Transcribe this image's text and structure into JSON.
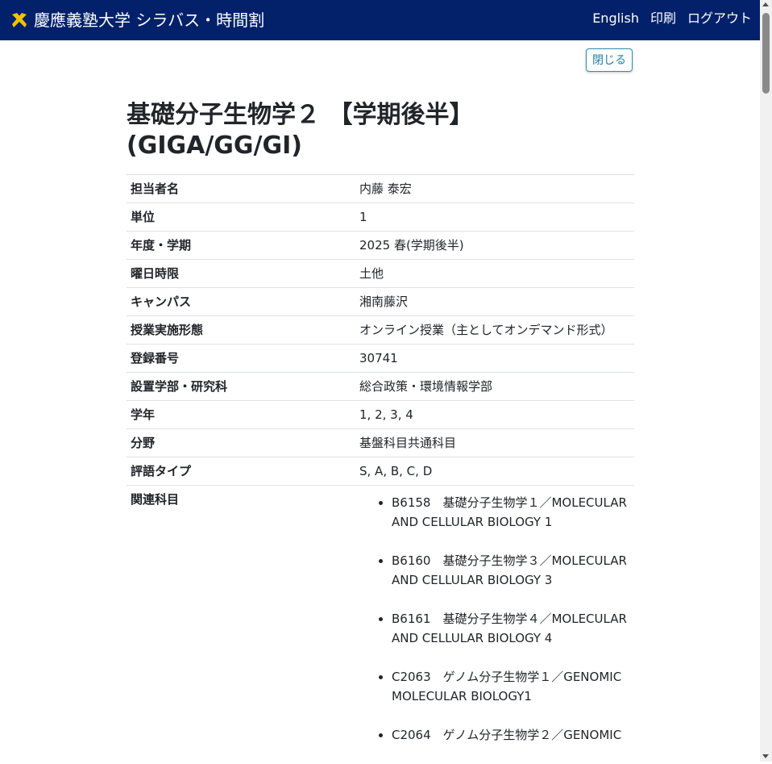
{
  "header": {
    "title": "慶應義塾大学 シラバス・時間割",
    "nav": [
      "English",
      "印刷",
      "ログアウト"
    ]
  },
  "close_button": "閉じる",
  "course": {
    "title": "基礎分子生物学２ 【学期後半】 (GIGA/GG/GI)"
  },
  "details": [
    {
      "label": "担当者名",
      "value": "内藤 泰宏"
    },
    {
      "label": "単位",
      "value": "1"
    },
    {
      "label": "年度・学期",
      "value": "2025 春(学期後半)"
    },
    {
      "label": "曜日時限",
      "value": "土他"
    },
    {
      "label": "キャンパス",
      "value": "湘南藤沢"
    },
    {
      "label": "授業実施形態",
      "value": "オンライン授業（主としてオンデマンド形式）"
    },
    {
      "label": "登録番号",
      "value": "30741"
    },
    {
      "label": "設置学部・研究科",
      "value": "総合政策・環境情報学部"
    },
    {
      "label": "学年",
      "value": "1, 2, 3, 4"
    },
    {
      "label": "分野",
      "value": "基盤科目共通科目"
    },
    {
      "label": "評語タイプ",
      "value": "S, A, B, C, D"
    }
  ],
  "related": {
    "label": "関連科目",
    "items": [
      "B6158　基礎分子生物学１／MOLECULAR AND CELLULAR BIOLOGY 1",
      "B6160　基礎分子生物学３／MOLECULAR AND CELLULAR BIOLOGY 3",
      "B6161　基礎分子生物学４／MOLECULAR AND CELLULAR BIOLOGY 4",
      "C2063　ゲノム分子生物学１／GENOMIC MOLECULAR BIOLOGY1",
      "C2064　ゲノム分子生物学２／GENOMIC"
    ]
  },
  "colors": {
    "header_bg": "#03216b",
    "logo": "#f2c200",
    "button_border": "#2f8fb0"
  }
}
